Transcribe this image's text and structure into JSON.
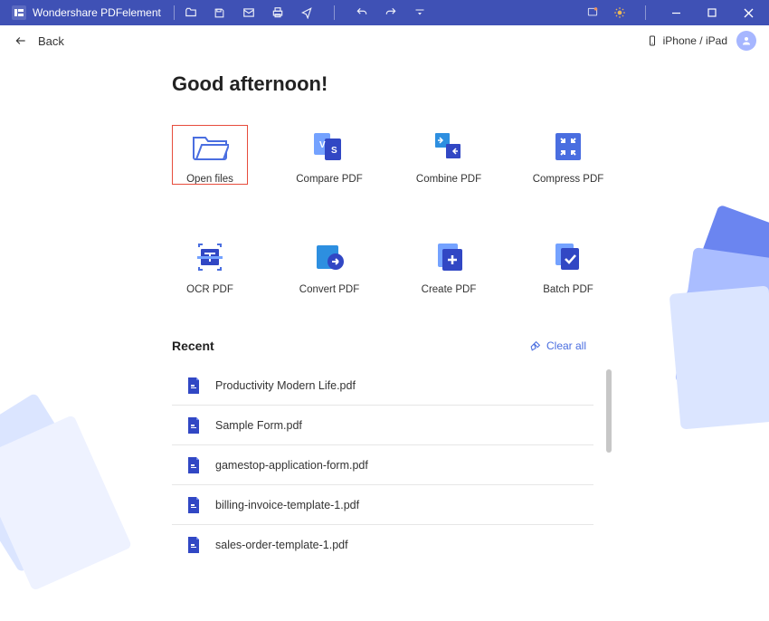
{
  "titlebar": {
    "title": "Wondershare PDFelement"
  },
  "toolbar": {
    "back": "Back",
    "device_label": "iPhone / iPad"
  },
  "heading": "Good afternoon!",
  "tiles": [
    {
      "label": "Open files"
    },
    {
      "label": "Compare PDF"
    },
    {
      "label": "Combine PDF"
    },
    {
      "label": "Compress PDF"
    },
    {
      "label": "OCR PDF"
    },
    {
      "label": "Convert PDF"
    },
    {
      "label": "Create PDF"
    },
    {
      "label": "Batch PDF"
    }
  ],
  "recent": {
    "title": "Recent",
    "clear_label": "Clear all",
    "items": [
      "Productivity Modern Life.pdf",
      "Sample Form.pdf",
      "gamestop-application-form.pdf",
      "billing-invoice-template-1.pdf",
      "sales-order-template-1.pdf"
    ]
  },
  "colors": {
    "brand": "#3f51b5",
    "accent": "#4a6ee0",
    "highlight": "#e74c3c"
  }
}
